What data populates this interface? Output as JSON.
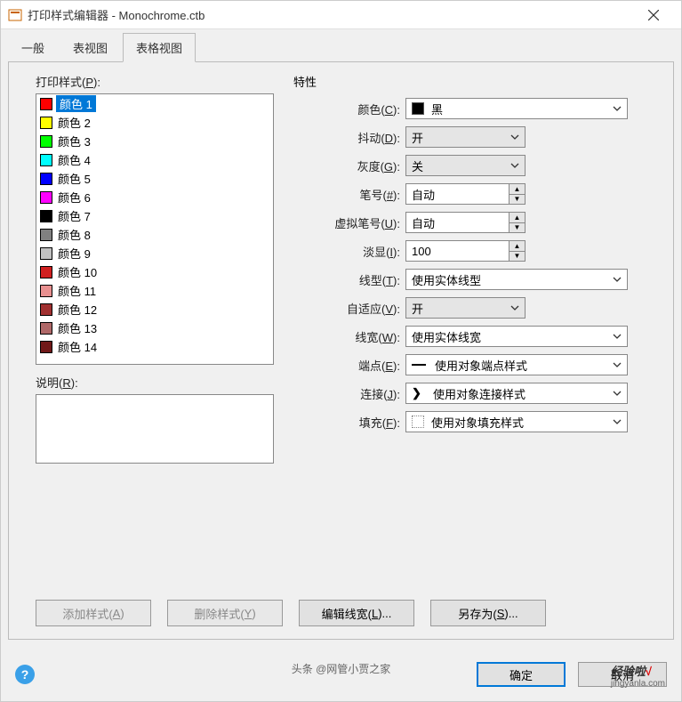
{
  "window": {
    "title": "打印样式编辑器 - Monochrome.ctb"
  },
  "tabs": {
    "general": "一般",
    "formview": "表视图",
    "tableview": "表格视图"
  },
  "left": {
    "styles_label_pre": "打印样式(",
    "styles_key": "P",
    "styles_label_post": "):",
    "desc_label_pre": "说明(",
    "desc_key": "R",
    "desc_label_post": "):",
    "items": [
      {
        "color": "#ff0000",
        "label": "颜色 1",
        "selected": true
      },
      {
        "color": "#ffff00",
        "label": "颜色 2"
      },
      {
        "color": "#00ff00",
        "label": "颜色 3"
      },
      {
        "color": "#00ffff",
        "label": "颜色 4"
      },
      {
        "color": "#0000ff",
        "label": "颜色 5"
      },
      {
        "color": "#ff00ff",
        "label": "颜色 6"
      },
      {
        "color": "#000000",
        "label": "颜色 7"
      },
      {
        "color": "#808080",
        "label": "颜色 8"
      },
      {
        "color": "#c0c0c0",
        "label": "颜色 9"
      },
      {
        "color": "#d02020",
        "label": "颜色 10"
      },
      {
        "color": "#e89090",
        "label": "颜色 11"
      },
      {
        "color": "#a03030",
        "label": "颜色 12"
      },
      {
        "color": "#b06868",
        "label": "颜色 13"
      },
      {
        "color": "#701818",
        "label": "颜色 14"
      }
    ]
  },
  "props": {
    "title": "特性",
    "rows": {
      "color": {
        "pre": "颜色(",
        "key": "C",
        "post": "):",
        "value": "黑",
        "swatch": "#000000"
      },
      "dither": {
        "pre": "抖动(",
        "key": "D",
        "post": "):",
        "value": "开"
      },
      "gray": {
        "pre": "灰度(",
        "key": "G",
        "post": "):",
        "value": "关"
      },
      "pen": {
        "pre": "笔号(",
        "key": "#",
        "post": "):",
        "value": "自动"
      },
      "vpen": {
        "pre": "虚拟笔号(",
        "key": "U",
        "post": "):",
        "value": "自动"
      },
      "fade": {
        "pre": "淡显(",
        "key": "I",
        "post": "):",
        "value": "100"
      },
      "linetype": {
        "pre": "线型(",
        "key": "T",
        "post": "):",
        "value": "使用实体线型"
      },
      "adaptive": {
        "pre": "自适应(",
        "key": "V",
        "post": "):",
        "value": "开"
      },
      "lwidth": {
        "pre": "线宽(",
        "key": "W",
        "post": "):",
        "value": "使用实体线宽"
      },
      "endcap": {
        "pre": "端点(",
        "key": "E",
        "post": "):",
        "value": "使用对象端点样式"
      },
      "join": {
        "pre": "连接(",
        "key": "J",
        "post": "):",
        "value": "使用对象连接样式"
      },
      "fill": {
        "pre": "填充(",
        "key": "F",
        "post": "):",
        "value": "使用对象填充样式"
      }
    }
  },
  "buttons": {
    "add": {
      "pre": "添加样式(",
      "key": "A",
      "post": ")"
    },
    "delete": {
      "pre": "删除样式(",
      "key": "Y",
      "post": ")"
    },
    "editlw": {
      "pre": "编辑线宽(",
      "key": "L",
      "post": ")..."
    },
    "saveas": {
      "pre": "另存为(",
      "key": "S",
      "post": ")..."
    },
    "ok": "确定",
    "cancel": "取消"
  },
  "watermark": {
    "line1a": "经验啦",
    "line1b": "√",
    "line2": "jingyanla.com",
    "byline": "头条 @网管小贾之家"
  }
}
